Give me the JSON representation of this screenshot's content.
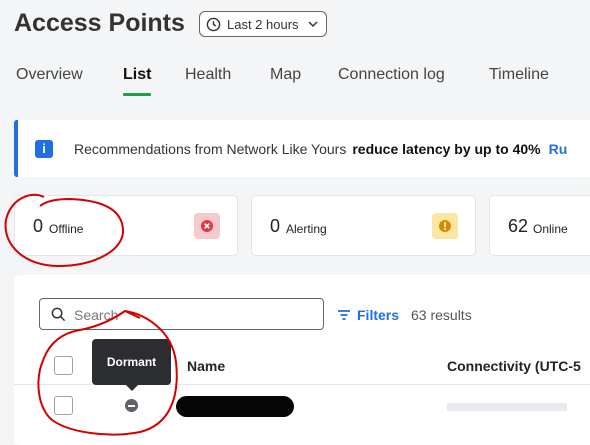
{
  "header": {
    "title": "Access Points",
    "time_range": "Last 2 hours"
  },
  "tabs": [
    {
      "label": "Overview",
      "active": false
    },
    {
      "label": "List",
      "active": true
    },
    {
      "label": "Health",
      "active": false
    },
    {
      "label": "Map",
      "active": false
    },
    {
      "label": "Connection log",
      "active": false
    },
    {
      "label": "Timeline",
      "active": false
    }
  ],
  "banner": {
    "text": "Recommendations from Network Like Yours",
    "highlight": "reduce latency by up to 40%",
    "link": "Ru",
    "icon": "info-icon"
  },
  "stats": [
    {
      "count": "0",
      "label": "Offline",
      "icon": "x-circle-icon",
      "color": "#d93b45"
    },
    {
      "count": "0",
      "label": "Alerting",
      "icon": "alert-circle-icon",
      "color": "#d48c00"
    },
    {
      "count": "62",
      "label": "Online",
      "icon": "",
      "color": ""
    }
  ],
  "search": {
    "placeholder": "Search",
    "filters_label": "Filters",
    "results": "63 results"
  },
  "table": {
    "columns": [
      "Name",
      "Connectivity (UTC-5"
    ],
    "rows": [
      {
        "status_tooltip": "Dormant",
        "status_icon": "dormant-icon"
      }
    ]
  },
  "colors": {
    "accent": "#1f6fe0",
    "active_tab": "#1aa14a",
    "annotation": "#d40000"
  }
}
